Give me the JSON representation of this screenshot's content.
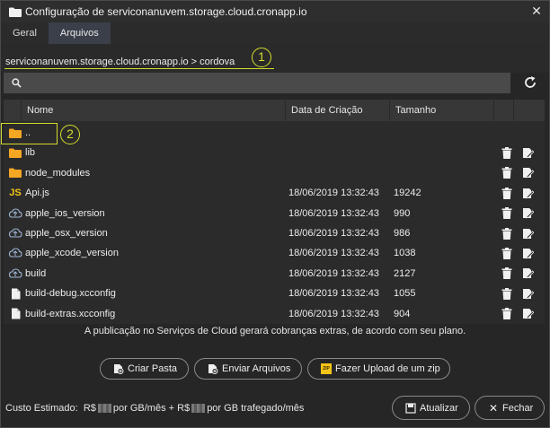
{
  "window": {
    "title": "Configuração de serviconanuvem.storage.cloud.cronapp.io",
    "close_glyph": "✕"
  },
  "tabs": [
    {
      "label": "Geral"
    },
    {
      "label": "Arquivos",
      "active": true
    }
  ],
  "breadcrumb": {
    "path": "serviconanuvem.storage.cloud.cronapp.io > cordova",
    "marker": "1"
  },
  "search": {
    "placeholder": "",
    "value": ""
  },
  "table": {
    "headers": {
      "name": "Nome",
      "date": "Data de Criação",
      "size": "Tamanho"
    },
    "highlight_marker": "2",
    "rows": [
      {
        "icon": "folder-icon",
        "name": "..",
        "date": "",
        "size": "",
        "actions": false
      },
      {
        "icon": "folder-icon",
        "name": "lib",
        "date": "",
        "size": "",
        "actions": true
      },
      {
        "icon": "folder-icon",
        "name": "node_modules",
        "date": "",
        "size": "",
        "actions": true
      },
      {
        "icon": "js-file-icon",
        "name": "Api.js",
        "date": "18/06/2019 13:32:43",
        "size": "19242",
        "actions": true
      },
      {
        "icon": "cloud-file-icon",
        "name": "apple_ios_version",
        "date": "18/06/2019 13:32:43",
        "size": "990",
        "actions": true
      },
      {
        "icon": "cloud-file-icon",
        "name": "apple_osx_version",
        "date": "18/06/2019 13:32:43",
        "size": "986",
        "actions": true
      },
      {
        "icon": "cloud-file-icon",
        "name": "apple_xcode_version",
        "date": "18/06/2019 13:32:43",
        "size": "1038",
        "actions": true
      },
      {
        "icon": "cloud-file-icon",
        "name": "build",
        "date": "18/06/2019 13:32:43",
        "size": "2127",
        "actions": true
      },
      {
        "icon": "file-icon",
        "name": "build-debug.xcconfig",
        "date": "18/06/2019 13:32:43",
        "size": "1055",
        "actions": true
      },
      {
        "icon": "file-icon",
        "name": "build-extras.xcconfig",
        "date": "18/06/2019 13:32:43",
        "size": "904",
        "actions": true
      }
    ]
  },
  "notice": "A publicação no Serviços de Cloud gerará cobranças extras, de acordo com seu plano.",
  "actions": {
    "create_folder": "Criar Pasta",
    "send_files": "Enviar Arquivos",
    "upload_zip": "Fazer Upload de um zip",
    "zip_badge": "ZIP"
  },
  "cost": {
    "label": "Custo Estimado:",
    "currency1": "R$",
    "per_gb": "por GB/mês +",
    "currency2": "R$",
    "per_traffic": "por GB trafegado/mês"
  },
  "footer": {
    "update": "Atualizar",
    "close": "Fechar",
    "close_glyph": "✕"
  },
  "colors": {
    "folder": "#f5a623",
    "js": "#f5c518",
    "accent_marker": "#d4dc2c",
    "active_tab": "#3b3f4a"
  }
}
